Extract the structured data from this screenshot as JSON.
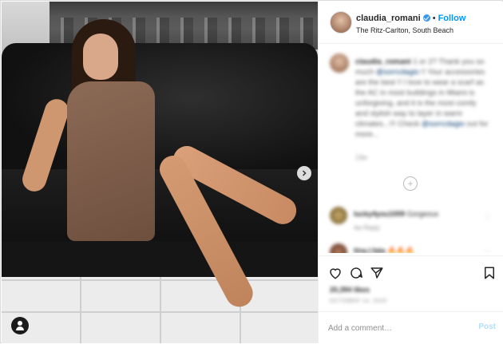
{
  "post": {
    "username": "claudia_romani",
    "separator": "•",
    "follow_label": "Follow",
    "location": "The Ritz-Carlton, South Beach"
  },
  "caption": {
    "username": "claudia_romani",
    "line1": "1 or 2? Thank you so much",
    "mention1": "@sorrcdagio",
    "line2": "!! Your accessories are the best !! I love to wear a scarf as the AC in most buildings in Miami is unforgiving,",
    "line3": "and it is the most comfy and stylish way to layer in warm climates...!!! Check",
    "mention2": "@sorrcdagio",
    "line4": "out for more...",
    "time": "13w"
  },
  "comments": [
    {
      "username": "lucky4you1009",
      "text": "Gorgeous",
      "meta": "4w   Reply"
    },
    {
      "username": "tina.l.fata",
      "text": "🔥🔥🔥"
    }
  ],
  "actions": {
    "likes": "20,394 likes",
    "date": "OCTOBER 14, 2020"
  },
  "comment_bar": {
    "placeholder": "Add a comment…",
    "post_label": "Post"
  },
  "colors": {
    "accent": "#0095f6",
    "post_disabled": "#b2dffc",
    "verified": "#3897f0"
  },
  "icons": {
    "next": "chevron-right-icon",
    "tag": "user-tag-icon",
    "like": "heart-icon",
    "comment": "comment-icon",
    "share": "paper-plane-icon",
    "save": "bookmark-icon",
    "more": "plus-circle-icon"
  }
}
